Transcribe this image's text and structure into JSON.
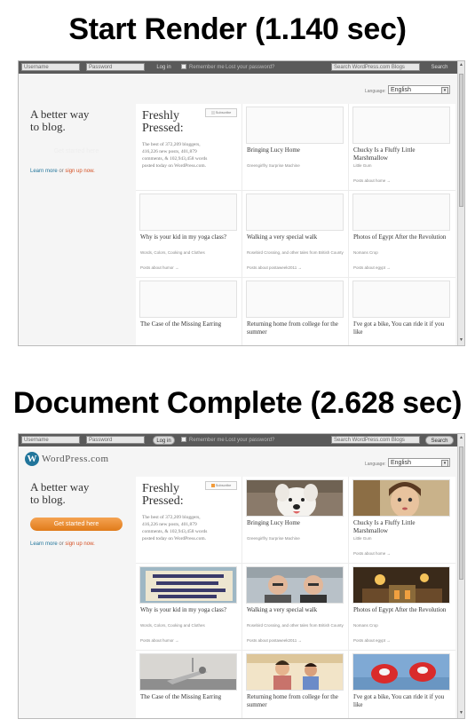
{
  "frames": [
    {
      "heading": "Start Render (1.140 sec)",
      "loaded": false
    },
    {
      "heading": "Document Complete (2.628 sec)",
      "loaded": true
    }
  ],
  "topbar": {
    "username_placeholder": "Username",
    "password_placeholder": "Password",
    "login_label": "Log in",
    "remember_label": "Remember me",
    "lost_password_label": "Lost your password?",
    "search_placeholder": "Search WordPress.com Blogs",
    "search_button": "Search"
  },
  "logo": {
    "mark": "W",
    "text": "WordPress.com"
  },
  "language": {
    "label": "Language:",
    "value": "English"
  },
  "hero": {
    "tagline_line1": "A better way",
    "tagline_line2": "to blog.",
    "cta_label": "Get started here",
    "learn_more": "Learn more",
    "or": "or",
    "sign_up": "sign up now."
  },
  "freshly_pressed": {
    "title_line1": "Freshly",
    "title_line2": "Pressed:",
    "subscribe_label": "Subscribe",
    "stats_line1": "The best of 372,209 bloggers,",
    "stats_line2": "416,226 new posts, 401,879",
    "stats_line3": "comments, & 102,943,458 words",
    "stats_line4": "posted today on WordPress.com."
  },
  "cards": [
    {
      "title": "Bringing Lucy Home",
      "meta": "Greengirlfry Surprise Machine",
      "link": "",
      "thumb": "dog"
    },
    {
      "title": "Chucky Is a Fluffy Little Marshmallow",
      "meta": "Little Gum",
      "link": "Posts about home →",
      "thumb": "doll"
    },
    {
      "title": "Why is your kid in my yoga class?",
      "meta": "Words, Colors, Cooking and Clothes",
      "link": "Posts about humor →",
      "thumb": "sign"
    },
    {
      "title": "Walking a very special walk",
      "meta": "Rosebird Crossing, and other tales from British County",
      "link": "Posts about postaweek2011 →",
      "thumb": "men"
    },
    {
      "title": "Photos of Egypt After the Revolution",
      "meta": "Nomans Crop",
      "link": "Posts about egypt →",
      "thumb": "egypt"
    },
    {
      "title": "The Case of the Missing Earring",
      "meta": "",
      "link": "",
      "thumb": "earring"
    },
    {
      "title": "Returning home from college for the summer",
      "meta": "",
      "link": "",
      "thumb": "kids"
    },
    {
      "title": "I've got a bike, You can ride it if you like",
      "meta": "",
      "link": "",
      "thumb": "shoes"
    }
  ]
}
